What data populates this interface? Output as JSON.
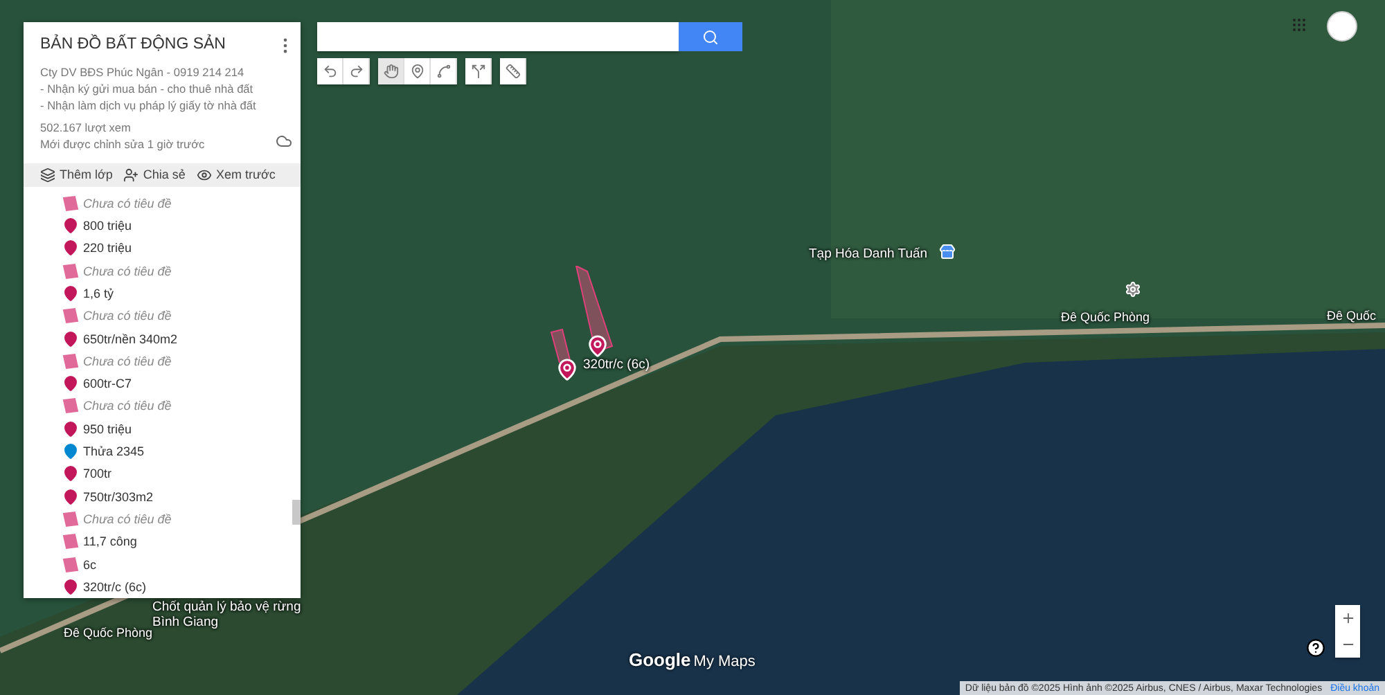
{
  "panel": {
    "title": "BẢN ĐỒ BẤT ĐỘNG SẢN",
    "description": [
      "Cty DV BĐS Phúc Ngân - 0919 214 214",
      "- Nhận ký gửi mua bán - cho thuê nhà đất",
      "- Nhận làm dịch vụ pháp lý giấy tờ nhà đất"
    ],
    "views": "502.167 lượt xem",
    "edited": "Mới được chỉnh sửa 1 giờ trước",
    "actions": [
      {
        "kind": "layer",
        "label": "Thêm lớp"
      },
      {
        "kind": "share",
        "label": "Chia sẻ"
      },
      {
        "kind": "preview",
        "label": "Xem trước"
      }
    ],
    "features": [
      {
        "kind": "polygon",
        "label": "Chưa có tiêu đề",
        "untitled": true,
        "color": "#e06a9a"
      },
      {
        "kind": "marker",
        "label": "800 triệu",
        "untitled": false,
        "color": "#c2185b"
      },
      {
        "kind": "marker",
        "label": "220 triệu",
        "untitled": false,
        "color": "#c2185b"
      },
      {
        "kind": "polygon",
        "label": "Chưa có tiêu đề",
        "untitled": true,
        "color": "#e06a9a"
      },
      {
        "kind": "marker",
        "label": "1,6 tỷ",
        "untitled": false,
        "color": "#c2185b"
      },
      {
        "kind": "polygon",
        "label": "Chưa có tiêu đề",
        "untitled": true,
        "color": "#e06a9a"
      },
      {
        "kind": "marker",
        "label": "650tr/nền 340m2",
        "untitled": false,
        "color": "#c2185b"
      },
      {
        "kind": "polygon",
        "label": "Chưa có tiêu đề",
        "untitled": true,
        "color": "#e06a9a"
      },
      {
        "kind": "marker",
        "label": "600tr-C7",
        "untitled": false,
        "color": "#c2185b"
      },
      {
        "kind": "polygon",
        "label": "Chưa có tiêu đề",
        "untitled": true,
        "color": "#e06a9a"
      },
      {
        "kind": "marker",
        "label": "950 triệu",
        "untitled": false,
        "color": "#c2185b"
      },
      {
        "kind": "marker",
        "label": "Thửa 2345",
        "untitled": false,
        "color": "#0288d1"
      },
      {
        "kind": "marker",
        "label": "700tr",
        "untitled": false,
        "color": "#c2185b"
      },
      {
        "kind": "marker",
        "label": "750tr/303m2",
        "untitled": false,
        "color": "#c2185b"
      },
      {
        "kind": "polygon",
        "label": "Chưa có tiêu đề",
        "untitled": true,
        "color": "#e06a9a"
      },
      {
        "kind": "polygon",
        "label": "11,7 công",
        "untitled": false,
        "color": "#e06a9a"
      },
      {
        "kind": "polygon",
        "label": "6c",
        "untitled": false,
        "color": "#e06a9a"
      },
      {
        "kind": "marker",
        "label": "320tr/c (6c)",
        "untitled": false,
        "color": "#c2185b"
      }
    ]
  },
  "tools": [
    {
      "kind": "undo",
      "selected": false
    },
    {
      "kind": "redo",
      "selected": false
    },
    {
      "kind": "hand",
      "selected": true
    },
    {
      "kind": "marker",
      "selected": false
    },
    {
      "kind": "line",
      "selected": false
    },
    {
      "kind": "directions",
      "selected": false
    },
    {
      "kind": "ruler",
      "selected": false
    }
  ],
  "map": {
    "labels": [
      {
        "kind": "place",
        "text": "Tạp Hóa Danh Tuấn"
      },
      {
        "kind": "road",
        "text": "Đê Quốc Phòng"
      },
      {
        "kind": "road",
        "text": "Đê Quốc"
      },
      {
        "kind": "road",
        "text": "Đê Quốc Phòng"
      },
      {
        "kind": "place",
        "text": "Chốt quản lý bảo vệ rừng Bình Giang"
      }
    ],
    "marker_label": "320tr/c (6c)"
  },
  "logo": {
    "brand": "Google",
    "product": "My Maps"
  },
  "attribution": "Dữ liệu bản đồ ©2025 Hình ảnh ©2025 Airbus, CNES / Airbus, Maxar Technologies",
  "terms": "Điều khoản"
}
